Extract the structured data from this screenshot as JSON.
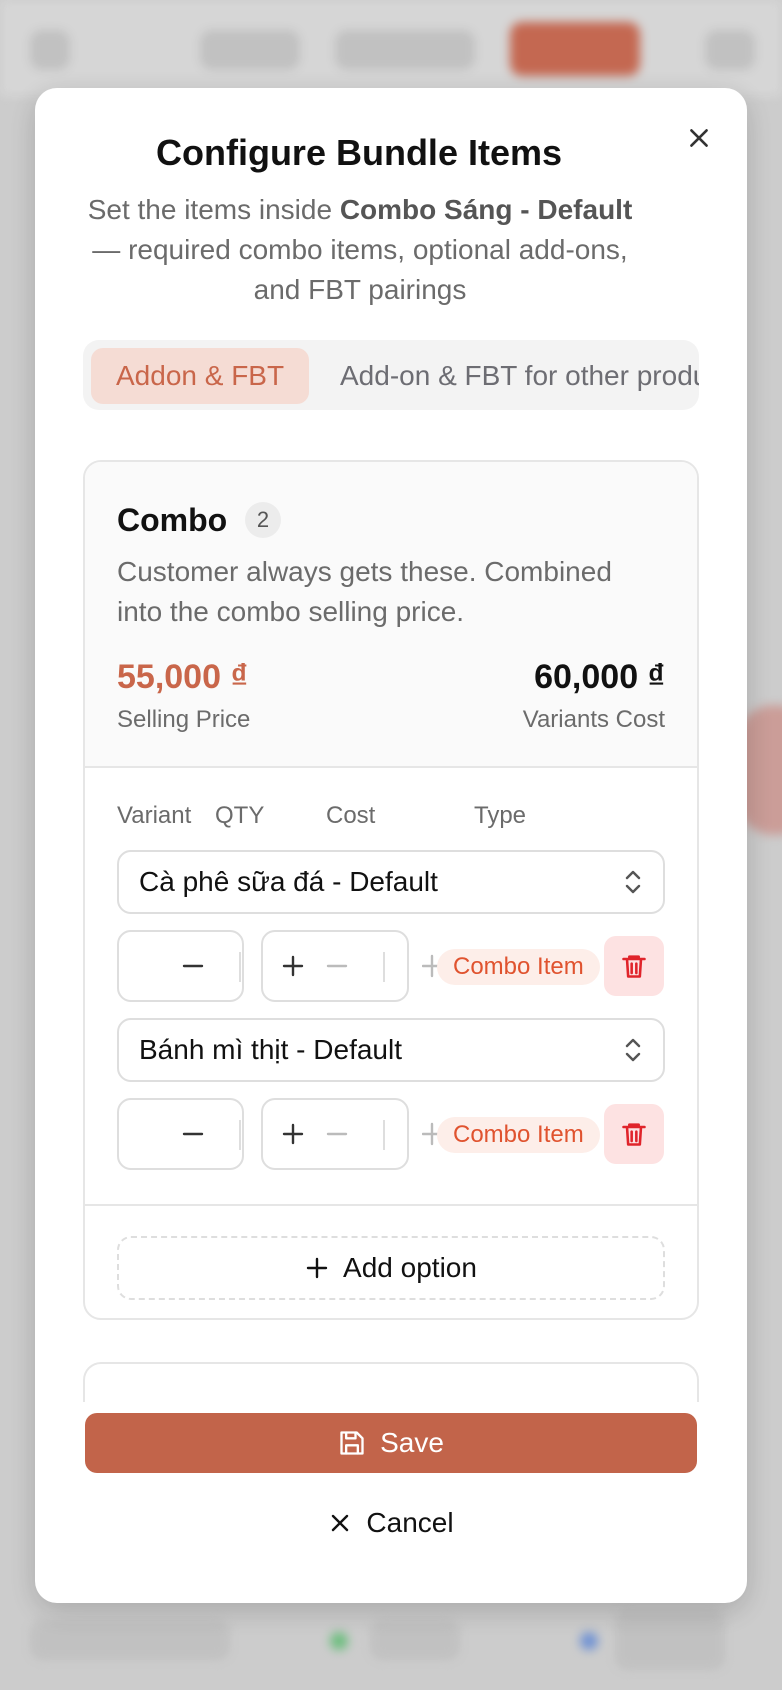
{
  "modal": {
    "title": "Configure Bundle Items",
    "subtitle_pre": "Set the items inside ",
    "subtitle_bold": "Combo Sáng - Default",
    "subtitle_post": " — required combo items, optional add-ons, and FBT pairings",
    "close_icon": "close-icon"
  },
  "tabs": [
    {
      "label": "Addon & FBT",
      "active": true
    },
    {
      "label": "Add-on & FBT for other products",
      "active": false
    }
  ],
  "combo": {
    "title": "Combo",
    "count": "2",
    "description": "Customer always gets these. Combined into the combo selling price.",
    "selling_price": "55,000 ₫",
    "selling_price_label": "Selling Price",
    "variants_cost": "60,000 ₫",
    "variants_cost_label": "Variants Cost",
    "columns": {
      "variant": "Variant",
      "qty": "QTY",
      "cost": "Cost",
      "type": "Type"
    },
    "items": [
      {
        "variant": "Cà phê sữa đá - Default",
        "qty": "",
        "cost": "",
        "type": "Combo Item"
      },
      {
        "variant": "Bánh mì thịt - Default",
        "qty": "",
        "cost": "",
        "type": "Combo Item"
      }
    ],
    "add_option_label": "Add option"
  },
  "footer": {
    "save_label": "Save",
    "cancel_label": "Cancel"
  },
  "colors": {
    "brand": "#c2644a",
    "brand_text": "#c9664a",
    "badge_text": "#e0532f",
    "danger": "#e0242b"
  }
}
